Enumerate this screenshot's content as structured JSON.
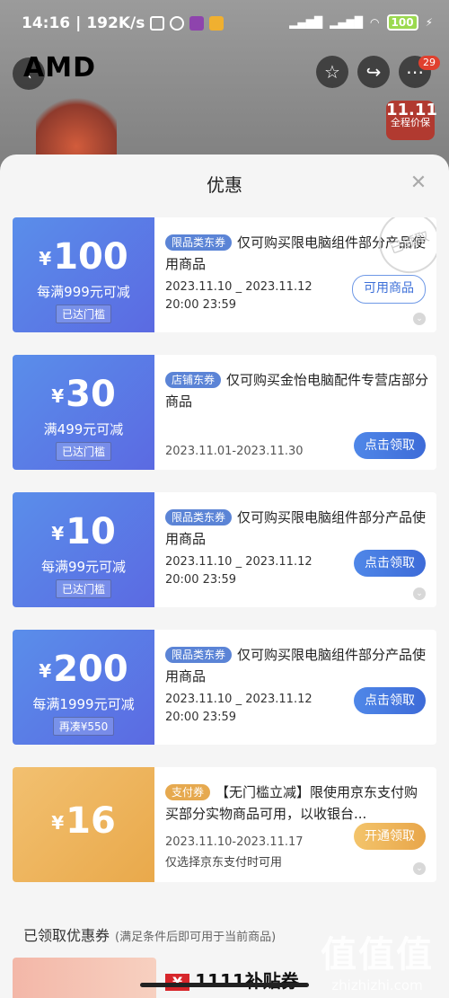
{
  "statusbar": {
    "time": "14:16",
    "speed": "192K/s",
    "battery": "100"
  },
  "background": {
    "brand": "AMD",
    "promo_top": "11.11",
    "promo_bottom": "全程价保",
    "notif_count": "29"
  },
  "sheet": {
    "title": "优惠",
    "close_icon": "close-icon"
  },
  "coupons": [
    {
      "amount": "100",
      "threshold": "每满999元可减",
      "status": "已达门槛",
      "type": "限品类东券",
      "desc": "仅可购买限电脑组件部分产品使用商品",
      "date_start": "2023.11.10 _ 2023.11.12",
      "date_end": "20:00 23:59",
      "action": "可用商品",
      "stamp": "已领取"
    },
    {
      "amount": "30",
      "threshold": "满499元可减",
      "status": "已达门槛",
      "type": "店铺东券",
      "desc": "仅可购买金怡电脑配件专营店部分商品",
      "date": "2023.11.01-2023.11.30",
      "action": "点击领取"
    },
    {
      "amount": "10",
      "threshold": "每满99元可减",
      "status": "已达门槛",
      "type": "限品类东券",
      "desc": "仅可购买限电脑组件部分产品使用商品",
      "date_start": "2023.11.10 _ 2023.11.12",
      "date_end": "20:00 23:59",
      "action": "点击领取"
    },
    {
      "amount": "200",
      "threshold": "每满1999元可减",
      "status": "再凑¥550",
      "type": "限品类东券",
      "desc": "仅可购买限电脑组件部分产品使用商品",
      "date_start": "2023.11.10 _ 2023.11.12",
      "date_end": "20:00 23:59",
      "action": "点击领取"
    },
    {
      "amount": "16",
      "type": "支付券",
      "desc": "【无门槛立减】限使用京东支付购买部分实物商品可用，以收银台...",
      "date": "2023.11.10-2023.11.17",
      "action": "开通领取",
      "note": "仅选择京东支付时可用"
    }
  ],
  "yen": "¥",
  "claimed": {
    "header": "已领取优惠券",
    "sub": "(满足条件后即可用于当前商品)",
    "label": "1111补贴券"
  },
  "watermark": {
    "big": "值值值",
    "small": "zhizhizhi.com"
  }
}
